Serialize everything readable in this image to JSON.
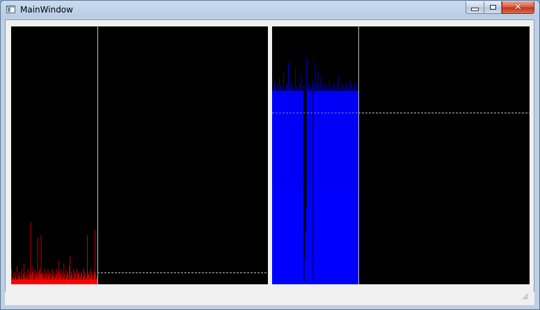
{
  "window": {
    "title": "MainWindow",
    "icon": "app-window-icon",
    "controls": {
      "minimize_icon": "minimize-icon",
      "maximize_icon": "maximize-icon",
      "close_label": "✕"
    }
  },
  "colors": {
    "plot_background": "#000000",
    "left_series": "#ff0000",
    "right_series": "#0000ff",
    "divider": "#c0c0c0",
    "dashed_threshold": "#c0c0c0"
  },
  "chart_data": [
    {
      "type": "bar",
      "name": "left-plot",
      "series_color": "#ff0000",
      "filled_fraction_of_width": 0.335,
      "divider_at_fraction": 0.335,
      "threshold_fraction": 0.045,
      "baseline_fraction": 0.018,
      "values": [
        0.06,
        0.03,
        0.02,
        0.04,
        0.02,
        0.05,
        0.03,
        0.02,
        0.07,
        0.02,
        0.04,
        0.03,
        0.05,
        0.02,
        0.03,
        0.06,
        0.02,
        0.04,
        0.08,
        0.03,
        0.05,
        0.02,
        0.04,
        0.03,
        0.06,
        0.02,
        0.05,
        0.04,
        0.24,
        0.03,
        0.05,
        0.07,
        0.04,
        0.02,
        0.06,
        0.03,
        0.05,
        0.04,
        0.18,
        0.03,
        0.05,
        0.06,
        0.04,
        0.19,
        0.03,
        0.05,
        0.04,
        0.02,
        0.06,
        0.03,
        0.05,
        0.04,
        0.02,
        0.06,
        0.04,
        0.03,
        0.05,
        0.02,
        0.04,
        0.06,
        0.03,
        0.05,
        0.02,
        0.04,
        0.03,
        0.06,
        0.04,
        0.02,
        0.05,
        0.09,
        0.03,
        0.04,
        0.06,
        0.02,
        0.05,
        0.03,
        0.08,
        0.04,
        0.02,
        0.06,
        0.03,
        0.05,
        0.04,
        0.02,
        0.07,
        0.11,
        0.03,
        0.05,
        0.04,
        0.02,
        0.06,
        0.03,
        0.05,
        0.04,
        0.02,
        0.06,
        0.03,
        0.05,
        0.04,
        0.02,
        0.03,
        0.05,
        0.04,
        0.02,
        0.06,
        0.03,
        0.05,
        0.04,
        0.02,
        0.03,
        0.19,
        0.05,
        0.04,
        0.02,
        0.06,
        0.03,
        0.05,
        0.04,
        0.02,
        0.03,
        0.05,
        0.21,
        0.04,
        0.02,
        0.03
      ]
    },
    {
      "type": "bar",
      "name": "right-plot",
      "series_color": "#0000ff",
      "filled_fraction_of_width": 0.335,
      "divider_at_fraction": 0.335,
      "threshold_fraction": 0.665,
      "solid_fill_fraction": 0.37,
      "plateau_fraction": 0.75,
      "values": [
        0.72,
        0.76,
        0.74,
        0.77,
        0.79,
        0.74,
        0.76,
        0.73,
        0.78,
        0.75,
        0.8,
        0.74,
        0.77,
        0.73,
        0.76,
        0.75,
        0.82,
        0.74,
        0.76,
        0.73,
        0.78,
        0.75,
        0.77,
        0.86,
        0.74,
        0.76,
        0.73,
        0.79,
        0.75,
        0.77,
        0.74,
        0.76,
        0.73,
        0.84,
        0.75,
        0.77,
        0.74,
        0.76,
        0.73,
        0.78,
        0.75,
        0.81,
        0.74,
        0.76,
        0.73,
        0.77,
        0.75,
        0.74,
        0.76,
        0.88,
        0.73,
        0.78,
        0.75,
        0.77,
        0.74,
        0.76,
        0.73,
        0.79,
        0.75,
        0.77,
        0.74,
        0.86,
        0.73,
        0.78,
        0.75,
        0.83,
        0.74,
        0.76,
        0.73,
        0.8,
        0.75,
        0.77,
        0.74,
        0.76,
        0.73,
        0.78,
        0.75,
        0.77,
        0.74,
        0.76,
        0.73,
        0.79,
        0.75,
        0.77,
        0.74,
        0.76,
        0.73,
        0.78,
        0.75,
        0.77,
        0.74,
        0.76,
        0.73,
        0.79,
        0.75,
        0.81,
        0.74,
        0.76,
        0.73,
        0.78,
        0.75,
        0.77,
        0.74,
        0.76,
        0.73,
        0.78,
        0.75,
        0.77,
        0.74,
        0.76,
        0.73,
        0.79,
        0.75,
        0.77,
        0.74,
        0.76,
        0.73,
        0.78,
        0.75,
        0.77,
        0.74,
        0.76,
        0.73
      ],
      "dips": [
        {
          "index": 45,
          "value": 0.01
        },
        {
          "index": 46,
          "value": 0.1
        },
        {
          "index": 47,
          "value": 0.2
        },
        {
          "index": 48,
          "value": 0.3
        },
        {
          "index": 58,
          "value": 0.02
        }
      ]
    }
  ],
  "status_bar": {
    "size_grip_icon": "size-grip-icon"
  }
}
